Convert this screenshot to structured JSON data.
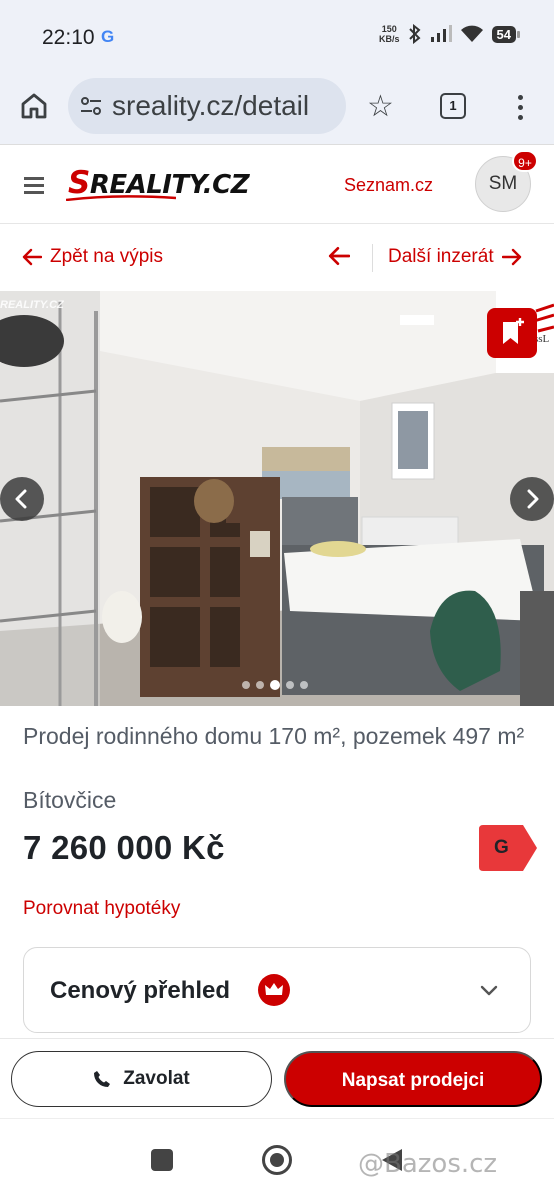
{
  "status_bar": {
    "time": "22:10",
    "google_indicator": "G",
    "net_speed_value": "150",
    "net_speed_unit": "KB/s",
    "battery": "54"
  },
  "browser": {
    "url": "sreality.cz/detail",
    "tab_count": "1",
    "icons": [
      "home-icon",
      "tune-icon",
      "star-icon",
      "tabs-icon",
      "more-vert-icon"
    ]
  },
  "site_header": {
    "logo_accent": "S",
    "logo_rest": "REALITY.CZ",
    "seznam_link": "Seznam.cz",
    "avatar_initials": "SM",
    "notification_badge": "9+"
  },
  "nav": {
    "back_label": "Zpět na výpis",
    "next_label": "Další inzerát"
  },
  "gallery": {
    "watermark": "REALITY.CZ",
    "agency_logo_text": "ssL",
    "slide_count": 5,
    "active_slide": 3
  },
  "listing": {
    "title": "Prodej rodinného domu 170 m², pozemek 497 m²",
    "location": "Bítovčice",
    "price": "7 260 000 Kč",
    "energy_class": "G",
    "mortgage_link": "Porovnat hypotéky",
    "price_overview_label": "Cenový přehled"
  },
  "actions": {
    "call_label": "Zavolat",
    "write_label": "Napsat prodejci"
  },
  "watermark_bottom": "@Bazos.cz",
  "colors": {
    "brand_red": "#cc0000",
    "browser_chrome": "#eef1f8",
    "text_dark": "#1f2328",
    "text_muted": "#555c66"
  }
}
